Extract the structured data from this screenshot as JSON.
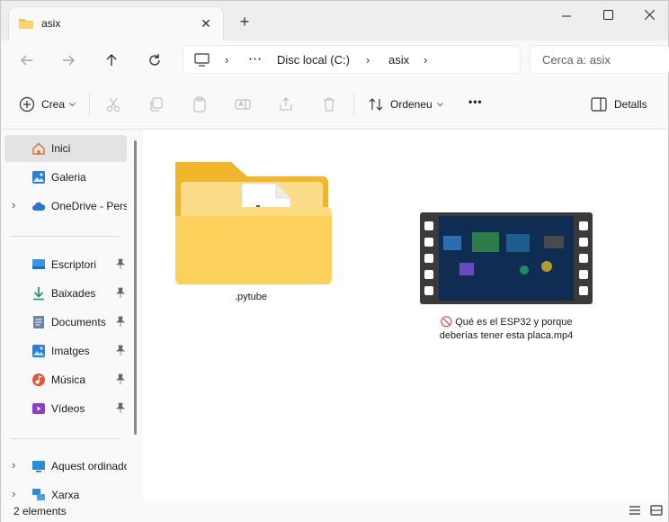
{
  "window": {
    "tab_title": "asix",
    "tab_close": "✕",
    "new_tab": "+",
    "minimize": "—",
    "maximize": "☐",
    "close": "✕"
  },
  "address": {
    "ellipsis": "⋯",
    "segments": [
      "Disc local (C:)",
      "asix"
    ],
    "separator": "›",
    "search_placeholder": "Cerca a: asix"
  },
  "toolbar": {
    "create_label": "Crea",
    "sort_label": "Ordeneu",
    "more_label": "•••",
    "details_label": "Detalls"
  },
  "sidebar": {
    "items": [
      {
        "label": "Inici",
        "icon": "home-icon",
        "active": true
      },
      {
        "label": "Galeria",
        "icon": "gallery-icon"
      },
      {
        "label": "OneDrive - Perso",
        "icon": "cloud-icon",
        "expandable": true
      },
      {
        "label": "Escriptori",
        "icon": "desktop-icon",
        "pinned": true
      },
      {
        "label": "Baixades",
        "icon": "download-icon",
        "pinned": true
      },
      {
        "label": "Documents",
        "icon": "documents-icon",
        "pinned": true
      },
      {
        "label": "Imatges",
        "icon": "pictures-icon",
        "pinned": true
      },
      {
        "label": "Música",
        "icon": "music-icon",
        "pinned": true
      },
      {
        "label": "Vídeos",
        "icon": "videos-icon",
        "pinned": true
      },
      {
        "label": "Aquest ordinador",
        "icon": "computer-icon",
        "expandable": true
      },
      {
        "label": "Xarxa",
        "icon": "network-icon",
        "expandable": true
      }
    ]
  },
  "content": {
    "files": [
      {
        "name": ".pytube",
        "type": "folder"
      },
      {
        "name_line1": "🚫 Qué es el ESP32 y porque",
        "name_line2": "deberías tener esta placa.mp4",
        "type": "video"
      }
    ]
  },
  "status": {
    "count": "2 elements"
  },
  "colors": {
    "folder": "#f8c63a",
    "accent": "#0067c0",
    "selection": "#e3e3e3"
  }
}
